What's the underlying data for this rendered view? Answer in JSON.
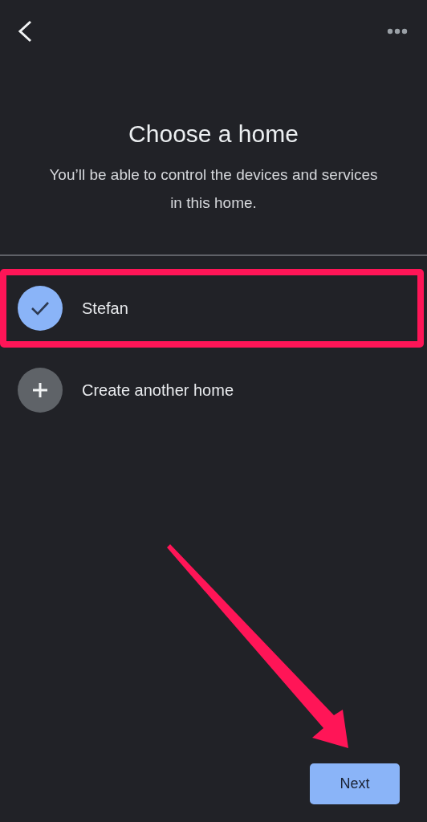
{
  "title": "Choose a home",
  "subtitle": "You’ll be able to control the devices and services in this home.",
  "homes": [
    {
      "name": "Stefan",
      "kind": "home",
      "selected": true,
      "highlighted": true
    },
    {
      "name": "Create another home",
      "kind": "create",
      "selected": false,
      "highlighted": false
    }
  ],
  "annotation_arrow": true,
  "next_button": "Next"
}
